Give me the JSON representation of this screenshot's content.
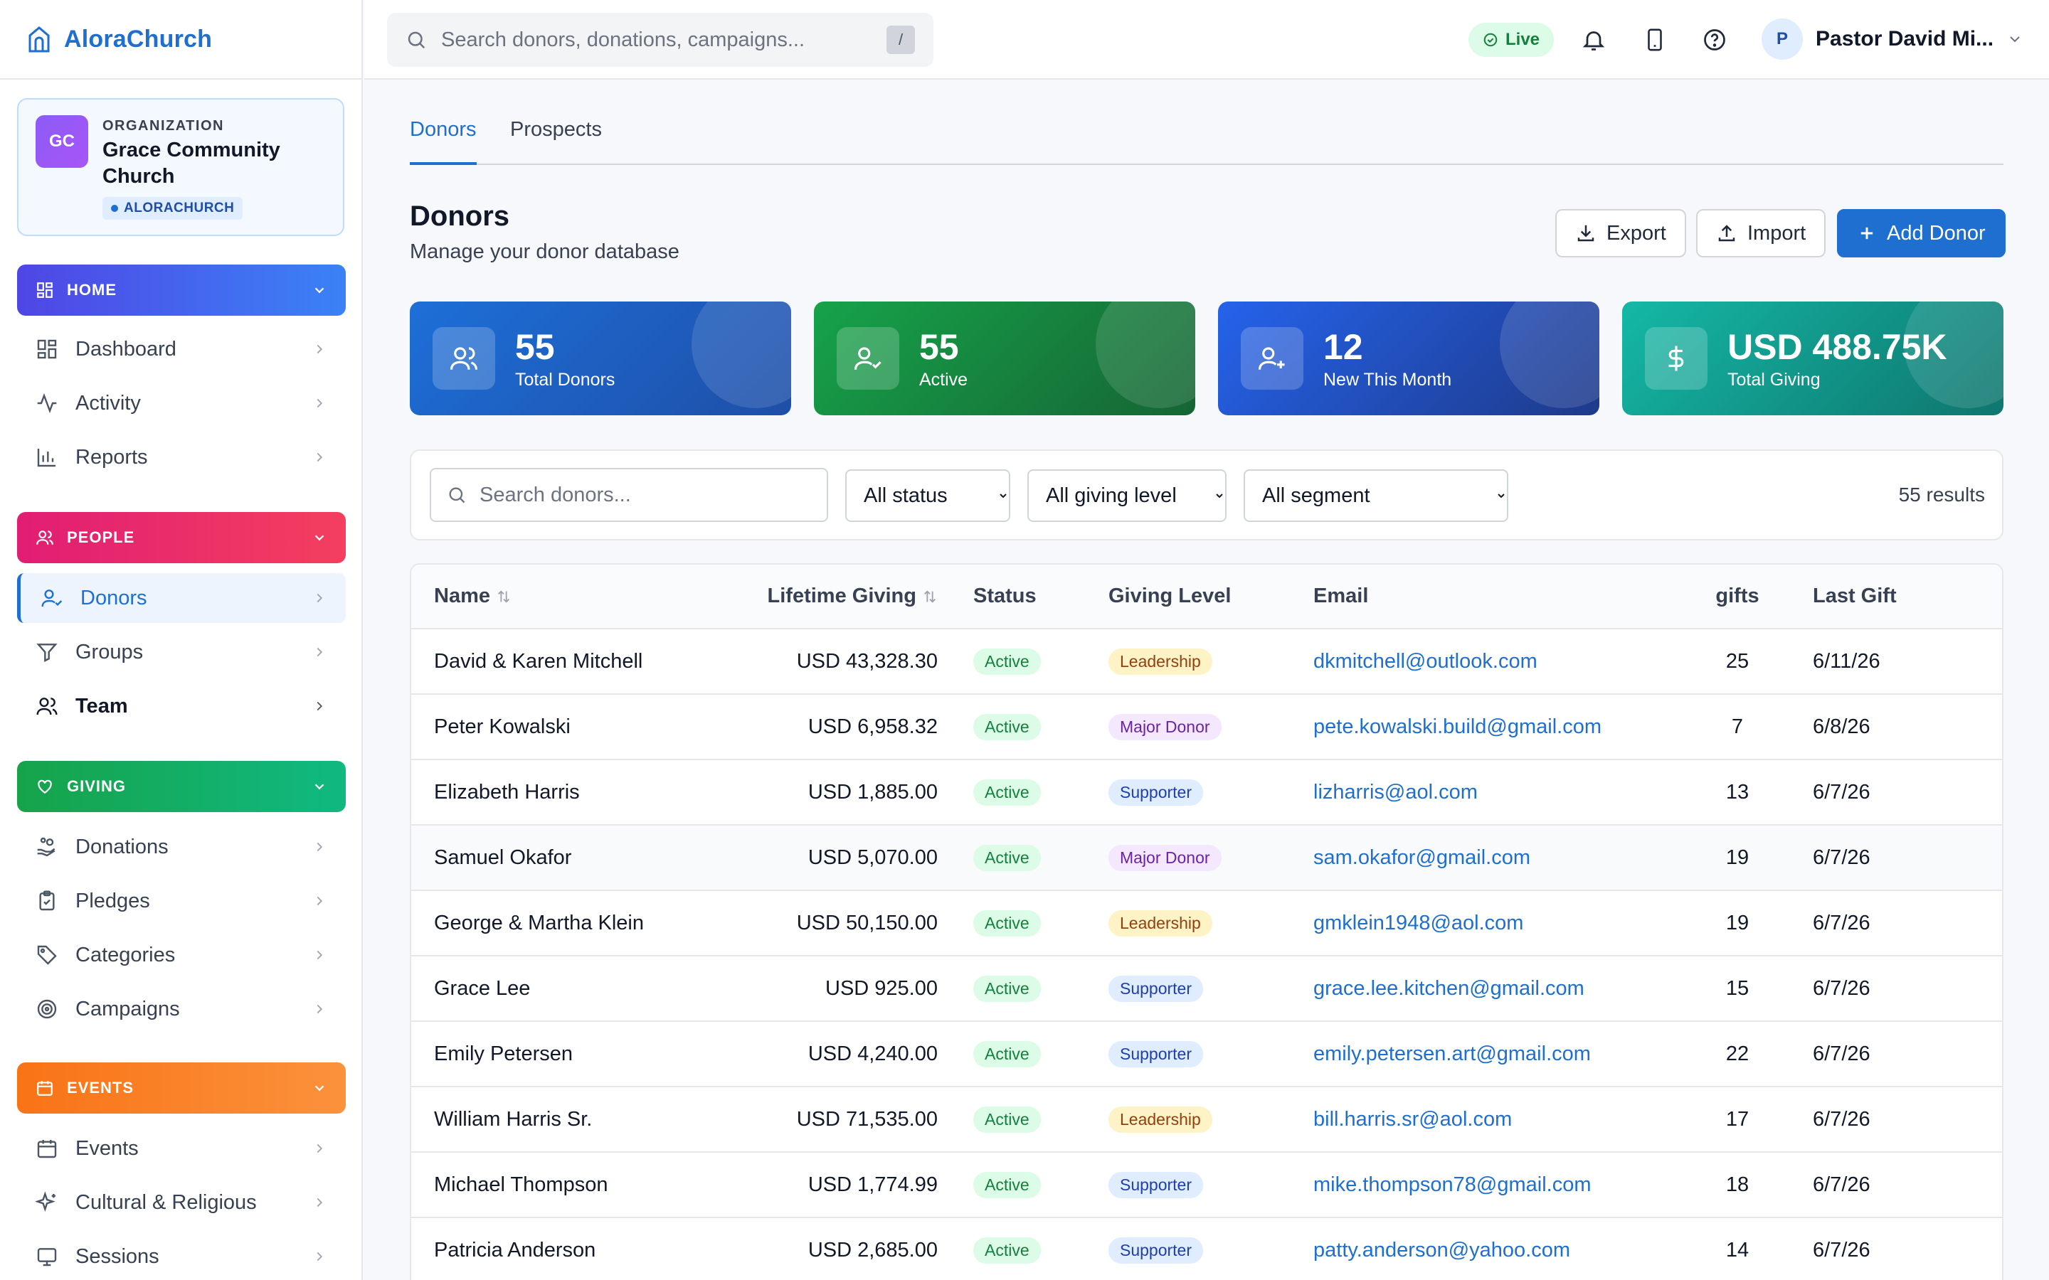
{
  "brand": {
    "name": "AloraChurch"
  },
  "org": {
    "initials": "GC",
    "kicker": "ORGANIZATION",
    "name": "Grace Community Church",
    "tag": "ALORACHURCH"
  },
  "sidebar": {
    "sections": [
      {
        "label": "HOME",
        "items": [
          "Dashboard",
          "Activity",
          "Reports"
        ]
      },
      {
        "label": "PEOPLE",
        "items": [
          "Donors",
          "Groups",
          "Team"
        ]
      },
      {
        "label": "GIVING",
        "items": [
          "Donations",
          "Pledges",
          "Categories",
          "Campaigns"
        ]
      },
      {
        "label": "EVENTS",
        "items": [
          "Events",
          "Cultural & Religious",
          "Sessions"
        ]
      }
    ],
    "active_item": "Donors"
  },
  "topbar": {
    "search_placeholder": "Search donors, donations, campaigns...",
    "shortcut": "/",
    "live": "Live",
    "user_initial": "P",
    "user_name": "Pastor David Mi..."
  },
  "tabs": [
    "Donors",
    "Prospects"
  ],
  "page": {
    "title": "Donors",
    "subtitle": "Manage your donor database",
    "export": "Export",
    "import": "Import",
    "add": "Add Donor"
  },
  "stats": [
    {
      "value": "55",
      "label": "Total Donors",
      "icon": "users-icon"
    },
    {
      "value": "55",
      "label": "Active",
      "icon": "user-check-icon"
    },
    {
      "value": "12",
      "label": "New This Month",
      "icon": "user-plus-icon"
    },
    {
      "value": "USD 488.75K",
      "label": "Total Giving",
      "icon": "dollar-icon"
    }
  ],
  "filters": {
    "search_placeholder": "Search donors...",
    "status": "All status",
    "giving_level": "All giving level",
    "segment": "All segment",
    "results": "55 results"
  },
  "table": {
    "headers": [
      "Name",
      "Lifetime Giving",
      "Status",
      "Giving Level",
      "Email",
      "gifts",
      "Last Gift"
    ],
    "rows": [
      [
        "David & Karen Mitchell",
        "USD 43,328.30",
        "Active",
        "Leadership",
        "dkmitchell@outlook.com",
        "25",
        "6/11/26"
      ],
      [
        "Peter Kowalski",
        "USD 6,958.32",
        "Active",
        "Major Donor",
        "pete.kowalski.build@gmail.com",
        "7",
        "6/8/26"
      ],
      [
        "Elizabeth Harris",
        "USD 1,885.00",
        "Active",
        "Supporter",
        "lizharris@aol.com",
        "13",
        "6/7/26"
      ],
      [
        "Samuel Okafor",
        "USD 5,070.00",
        "Active",
        "Major Donor",
        "sam.okafor@gmail.com",
        "19",
        "6/7/26"
      ],
      [
        "George & Martha Klein",
        "USD 50,150.00",
        "Active",
        "Leadership",
        "gmklein1948@aol.com",
        "19",
        "6/7/26"
      ],
      [
        "Grace Lee",
        "USD 925.00",
        "Active",
        "Supporter",
        "grace.lee.kitchen@gmail.com",
        "15",
        "6/7/26"
      ],
      [
        "Emily Petersen",
        "USD 4,240.00",
        "Active",
        "Supporter",
        "emily.petersen.art@gmail.com",
        "22",
        "6/7/26"
      ],
      [
        "William Harris Sr.",
        "USD 71,535.00",
        "Active",
        "Leadership",
        "bill.harris.sr@aol.com",
        "17",
        "6/7/26"
      ],
      [
        "Michael Thompson",
        "USD 1,774.99",
        "Active",
        "Supporter",
        "mike.thompson78@gmail.com",
        "18",
        "6/7/26"
      ],
      [
        "Patricia Anderson",
        "USD 2,685.00",
        "Active",
        "Supporter",
        "patty.anderson@yahoo.com",
        "14",
        "6/7/26"
      ]
    ]
  },
  "colors": {
    "accent": "#1e6fd0",
    "home": "#4f46e5",
    "people": "#e11d74",
    "giving": "#16a34a",
    "events": "#f97316"
  }
}
